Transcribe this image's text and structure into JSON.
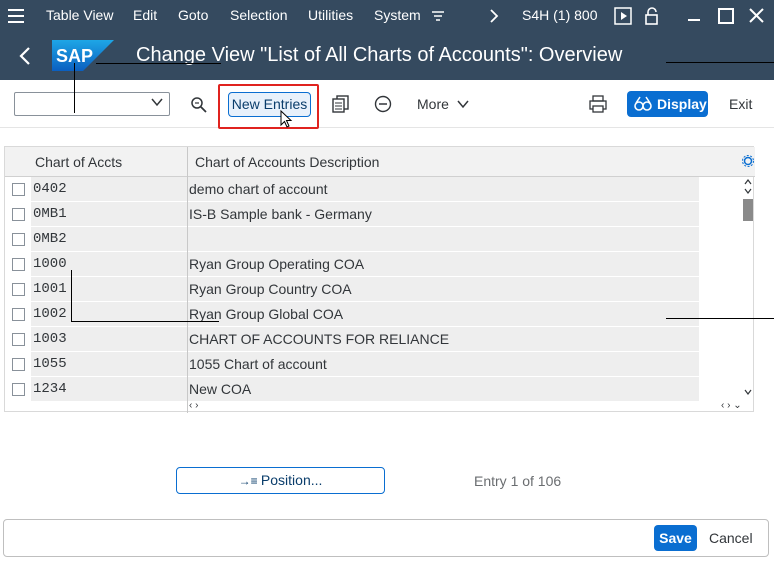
{
  "menubar": {
    "items": [
      "Table View",
      "Edit",
      "Goto",
      "Selection",
      "Utilities",
      "System"
    ],
    "system_id": "S4H (1) 800"
  },
  "title": {
    "logo": "SAP",
    "text": "Change View \"List of All Charts of Accounts\": Overview"
  },
  "toolbar": {
    "new_entries": "New Entries",
    "more": "More",
    "display": "Display",
    "exit": "Exit",
    "combo_value": ""
  },
  "table": {
    "headers": [
      "Chart of Accts",
      "Chart of Accounts Description"
    ],
    "rows": [
      {
        "code": "0402",
        "desc": "demo  chart of account"
      },
      {
        "code": "0MB1",
        "desc": "IS-B Sample bank - Germany"
      },
      {
        "code": "0MB2",
        "desc": ""
      },
      {
        "code": "1000",
        "desc": "Ryan Group Operating COA"
      },
      {
        "code": "1001",
        "desc": "Ryan Group Country COA"
      },
      {
        "code": "1002",
        "desc": "Ryan Group Global COA"
      },
      {
        "code": "1003",
        "desc": "CHART OF ACCOUNTS FOR RELIANCE"
      },
      {
        "code": "1055",
        "desc": "1055 Chart of account"
      },
      {
        "code": "1234",
        "desc": "New COA"
      }
    ]
  },
  "position_button": "Position...",
  "entry_info": "Entry 1 of 106",
  "footer": {
    "save": "Save",
    "cancel": "Cancel"
  },
  "colors": {
    "shell": "#354a5f",
    "accent": "#0a6ed1",
    "highlight": "#e0231f"
  }
}
